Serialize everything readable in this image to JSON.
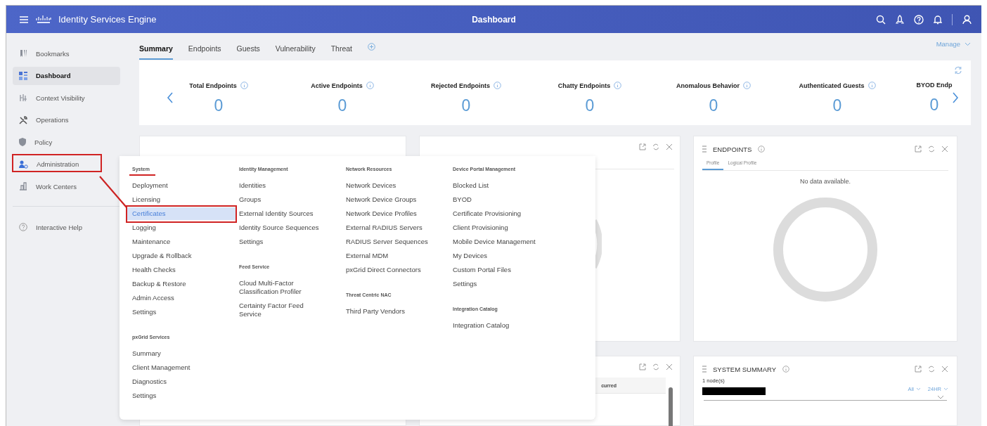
{
  "header": {
    "product": "Identity Services Engine",
    "title": "Dashboard"
  },
  "sidebar": {
    "items": [
      {
        "label": "Bookmarks",
        "selected": false,
        "marked": false
      },
      {
        "label": "Dashboard",
        "selected": true,
        "marked": false
      },
      {
        "label": "Context Visibility",
        "selected": false,
        "marked": false
      },
      {
        "label": "Operations",
        "selected": false,
        "marked": false
      },
      {
        "label": "Policy",
        "selected": false,
        "marked": false
      },
      {
        "label": "Administration",
        "selected": false,
        "marked": true
      },
      {
        "label": "Work Centers",
        "selected": false,
        "marked": false
      }
    ],
    "help": "Interactive Help"
  },
  "tabs": [
    {
      "label": "Summary",
      "selected": true
    },
    {
      "label": "Endpoints",
      "selected": false
    },
    {
      "label": "Guests",
      "selected": false
    },
    {
      "label": "Vulnerability",
      "selected": false
    },
    {
      "label": "Threat",
      "selected": false
    }
  ],
  "manage": "Manage",
  "metrics": [
    {
      "label": "Total Endpoints",
      "value": "0"
    },
    {
      "label": "Active Endpoints",
      "value": "0"
    },
    {
      "label": "Rejected Endpoints",
      "value": "0"
    },
    {
      "label": "Chatty Endpoints",
      "value": "0"
    },
    {
      "label": "Anomalous Behavior",
      "value": "0"
    },
    {
      "label": "Authenticated Guests",
      "value": "0"
    },
    {
      "label": "BYOD Endp",
      "value": "0"
    }
  ],
  "menu": {
    "columns": [
      {
        "sections": [
          {
            "heading": "System",
            "marked": true,
            "items": [
              {
                "label": "Deployment",
                "selected": false
              },
              {
                "label": "Licensing",
                "selected": false
              },
              {
                "label": "Certificates",
                "selected": true
              },
              {
                "label": "Logging",
                "selected": false
              },
              {
                "label": "Maintenance",
                "selected": false
              },
              {
                "label": "Upgrade & Rollback",
                "selected": false
              },
              {
                "label": "Health Checks",
                "selected": false
              },
              {
                "label": "Backup & Restore",
                "selected": false
              },
              {
                "label": "Admin Access",
                "selected": false
              },
              {
                "label": "Settings",
                "selected": false
              }
            ]
          },
          {
            "heading": "pxGrid Services",
            "marked": false,
            "items": [
              {
                "label": "Summary",
                "selected": false
              },
              {
                "label": "Client Management",
                "selected": false
              },
              {
                "label": "Diagnostics",
                "selected": false
              },
              {
                "label": "Settings",
                "selected": false
              }
            ]
          }
        ]
      },
      {
        "sections": [
          {
            "heading": "Identity Management",
            "marked": false,
            "items": [
              {
                "label": "Identities",
                "selected": false
              },
              {
                "label": "Groups",
                "selected": false
              },
              {
                "label": "External Identity Sources",
                "selected": false
              },
              {
                "label": "Identity Source Sequences",
                "selected": false
              },
              {
                "label": "Settings",
                "selected": false
              }
            ]
          },
          {
            "heading": "Feed Service",
            "marked": false,
            "items": [
              {
                "label": "Cloud Multi-Factor Classification Profiler",
                "selected": false
              },
              {
                "label": "Certainty Factor Feed Service",
                "selected": false
              }
            ]
          }
        ]
      },
      {
        "sections": [
          {
            "heading": "Network Resources",
            "marked": false,
            "items": [
              {
                "label": "Network Devices",
                "selected": false
              },
              {
                "label": "Network Device Groups",
                "selected": false
              },
              {
                "label": "Network Device Profiles",
                "selected": false
              },
              {
                "label": "External RADIUS Servers",
                "selected": false
              },
              {
                "label": "RADIUS Server Sequences",
                "selected": false
              },
              {
                "label": "External MDM",
                "selected": false
              },
              {
                "label": "pxGrid Direct Connectors",
                "selected": false
              }
            ]
          },
          {
            "heading": "Threat Centric NAC",
            "marked": false,
            "items": [
              {
                "label": "Third Party Vendors",
                "selected": false
              }
            ]
          }
        ]
      },
      {
        "sections": [
          {
            "heading": "Device Portal Management",
            "marked": false,
            "items": [
              {
                "label": "Blocked List",
                "selected": false
              },
              {
                "label": "BYOD",
                "selected": false
              },
              {
                "label": "Certificate Provisioning",
                "selected": false
              },
              {
                "label": "Client Provisioning",
                "selected": false
              },
              {
                "label": "Mobile Device Management",
                "selected": false
              },
              {
                "label": "My Devices",
                "selected": false
              },
              {
                "label": "Custom Portal Files",
                "selected": false
              },
              {
                "label": "Settings",
                "selected": false
              }
            ]
          },
          {
            "heading": "Integration Catalog",
            "marked": false,
            "items": [
              {
                "label": "Integration Catalog",
                "selected": false
              }
            ]
          }
        ]
      }
    ]
  },
  "endpoints_dashlet": {
    "title": "ENDPOINTS",
    "tabs": [
      {
        "label": "Profile",
        "selected": true
      },
      {
        "label": "Logical Profile",
        "selected": false
      }
    ],
    "message": "No data available."
  },
  "lower_middle_dashlet": {
    "column_header": "curred"
  },
  "system_summary": {
    "title": "SYSTEM SUMMARY",
    "nodes": "1 node(s)",
    "filters": [
      "All",
      "24HR"
    ]
  }
}
